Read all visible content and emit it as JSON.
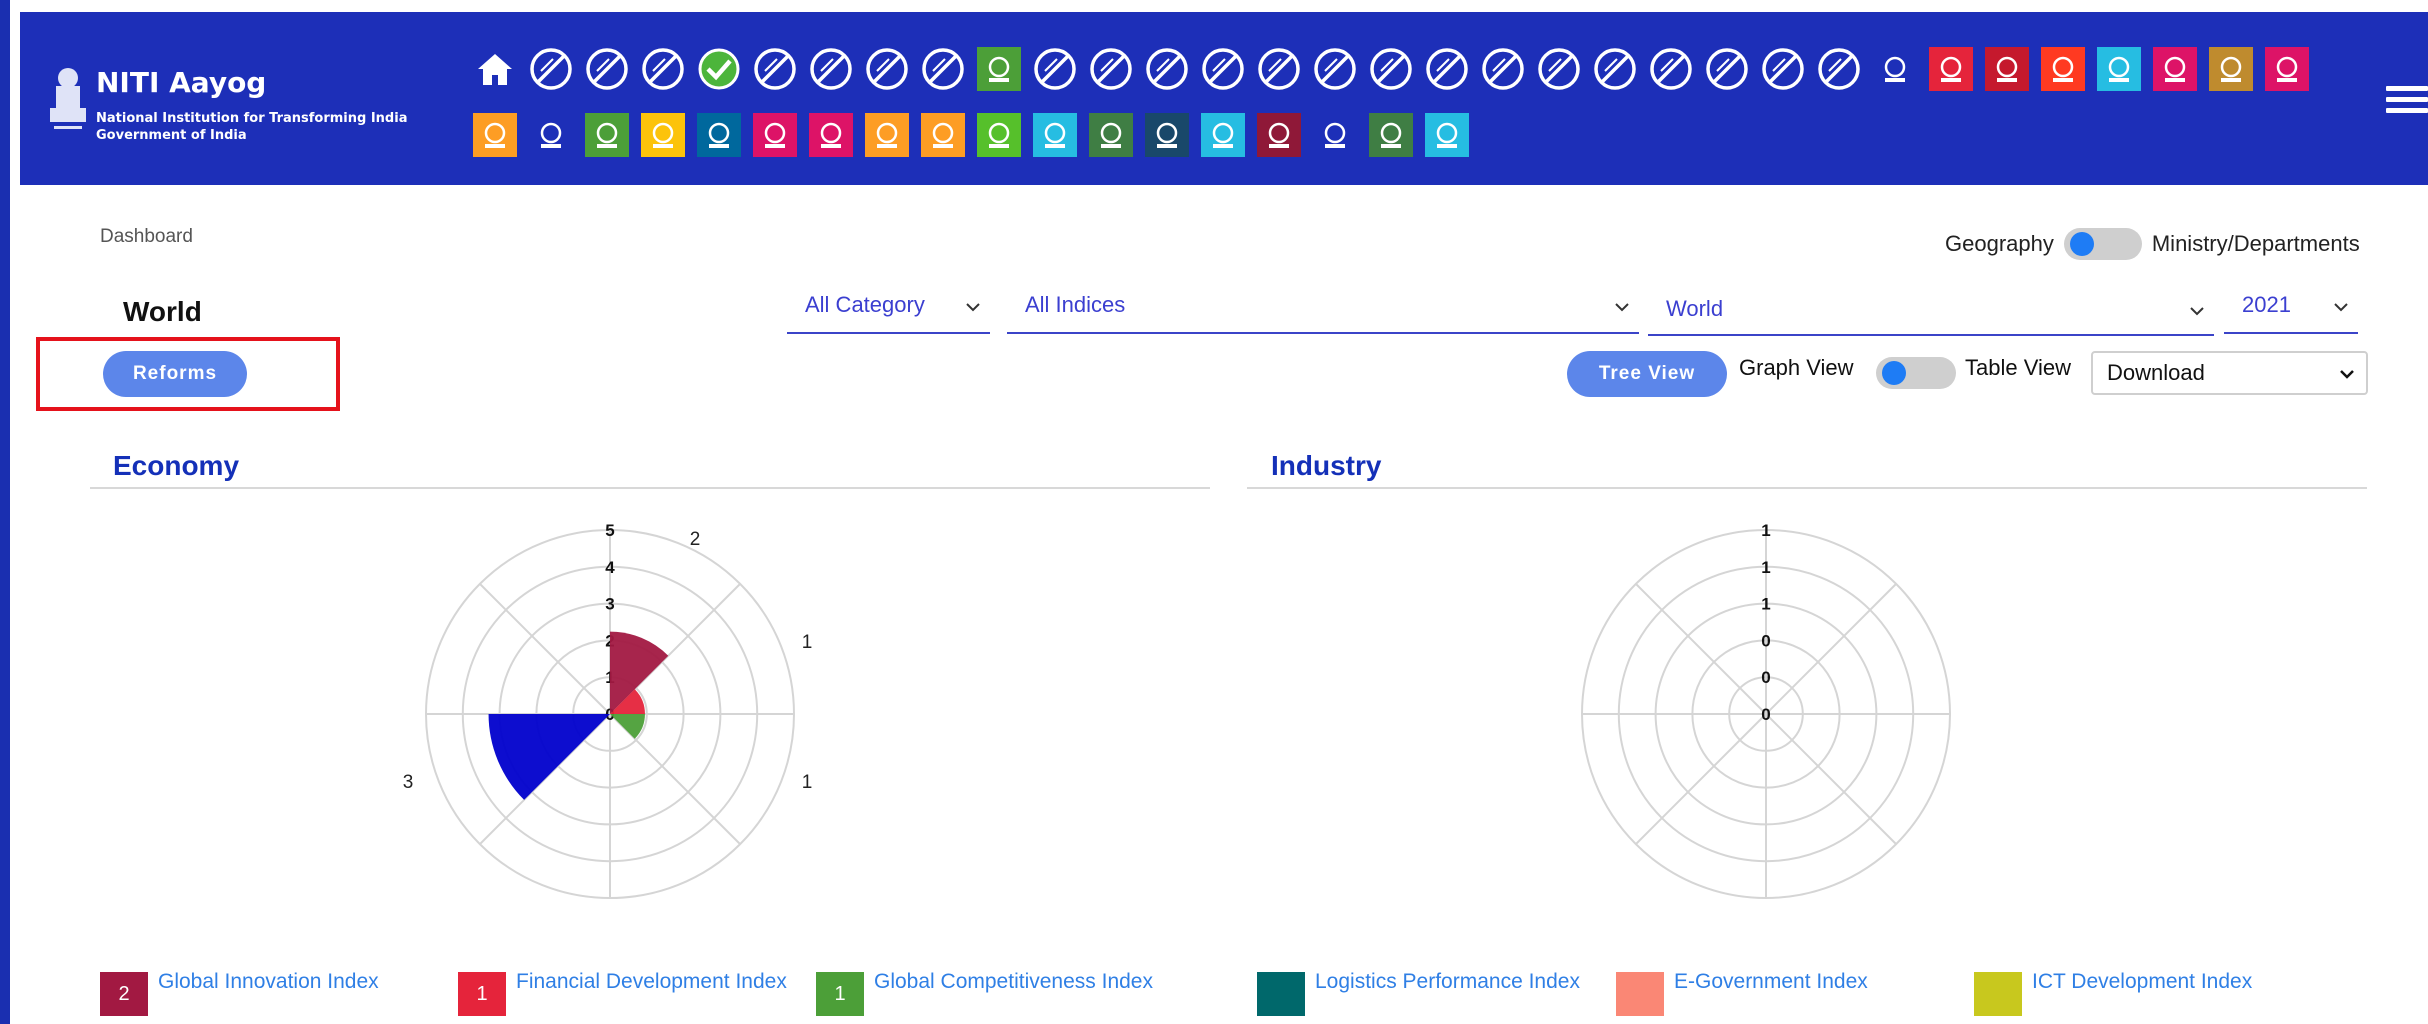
{
  "header": {
    "org_name": "NITI Aayog",
    "org_sub1": "National Institution for Transforming India",
    "org_sub2": "Government of India",
    "row1_icons": [
      {
        "name": "home-icon",
        "color": "#1d2fb8"
      },
      {
        "name": "na-icon",
        "color": "#1d2fb8"
      },
      {
        "name": "na-icon",
        "color": "#1d2fb8"
      },
      {
        "name": "na-icon",
        "color": "#1d2fb8"
      },
      {
        "name": "check-icon",
        "color": "#1d2fb8"
      },
      {
        "name": "na-icon",
        "color": "#1d2fb8"
      },
      {
        "name": "na-icon",
        "color": "#1d2fb8"
      },
      {
        "name": "na-icon",
        "color": "#1d2fb8"
      },
      {
        "name": "na-icon",
        "color": "#1d2fb8"
      },
      {
        "name": "food-bowl-icon",
        "color": "#4c9f38"
      },
      {
        "name": "na-icon",
        "color": "#1d2fb8"
      },
      {
        "name": "na-icon",
        "color": "#1d2fb8"
      },
      {
        "name": "na-icon",
        "color": "#1d2fb8"
      },
      {
        "name": "na-icon",
        "color": "#1d2fb8"
      },
      {
        "name": "na-icon",
        "color": "#1d2fb8"
      },
      {
        "name": "na-icon",
        "color": "#1d2fb8"
      },
      {
        "name": "na-icon",
        "color": "#1d2fb8"
      },
      {
        "name": "na-icon",
        "color": "#1d2fb8"
      },
      {
        "name": "na-icon",
        "color": "#1d2fb8"
      },
      {
        "name": "na-icon",
        "color": "#1d2fb8"
      },
      {
        "name": "na-icon",
        "color": "#1d2fb8"
      },
      {
        "name": "na-icon",
        "color": "#1d2fb8"
      },
      {
        "name": "na-icon",
        "color": "#1d2fb8"
      },
      {
        "name": "na-icon",
        "color": "#1d2fb8"
      },
      {
        "name": "na-icon",
        "color": "#1d2fb8"
      },
      {
        "name": "globe-icon",
        "color": "#1d2fb8"
      },
      {
        "name": "hands-coins-icon",
        "color": "#e5243b"
      },
      {
        "name": "education-icon",
        "color": "#c5192d"
      },
      {
        "name": "gender-icon",
        "color": "#ff3a21"
      },
      {
        "name": "justice-scale-icon",
        "color": "#26bde2"
      },
      {
        "name": "certificate-icon",
        "color": "#dd1367"
      },
      {
        "name": "chart-board-icon",
        "color": "#bf8b2e"
      },
      {
        "name": "worker-icon",
        "color": "#dd1367"
      }
    ],
    "row2_icons": [
      {
        "name": "fruit-icon",
        "color": "#fd9d24"
      },
      {
        "name": "dove-icon",
        "color": "#1d2fb8"
      },
      {
        "name": "newspaper-icon",
        "color": "#4c9f38"
      },
      {
        "name": "handshake-icon",
        "color": "#fcc30b"
      },
      {
        "name": "gavel-icon",
        "color": "#00689d"
      },
      {
        "name": "raised-hands-icon",
        "color": "#dd1367"
      },
      {
        "name": "earth-icon",
        "color": "#dd1367"
      },
      {
        "name": "sprout-icon",
        "color": "#fd9d24"
      },
      {
        "name": "network-icon",
        "color": "#fd9d24"
      },
      {
        "name": "sparkle-icon",
        "color": "#56c02b"
      },
      {
        "name": "bar-chart-icon",
        "color": "#26bde2"
      },
      {
        "name": "bank-icon",
        "color": "#3f7e44"
      },
      {
        "name": "truck-icon",
        "color": "#19486a"
      },
      {
        "name": "target-icon",
        "color": "#26bde2"
      },
      {
        "name": "report-icon",
        "color": "#8f1838"
      },
      {
        "name": "people-icon",
        "color": "#1d2fb8"
      },
      {
        "name": "money-stack-icon",
        "color": "#3f7e44"
      },
      {
        "name": "lightbulb-icon",
        "color": "#26bde2"
      }
    ]
  },
  "breadcrumb": "Dashboard",
  "toggle": {
    "left": "Geography",
    "right": "Ministry/Departments"
  },
  "geo_title": "World",
  "filters": {
    "category": "All Category",
    "indices": "All Indices",
    "geography": "World",
    "year": "2021"
  },
  "buttons": {
    "reforms": "Reforms",
    "tree_view": "Tree View"
  },
  "view_toggle": {
    "left": "Graph View",
    "right": "Table View"
  },
  "download": "Download",
  "sections": {
    "economy": {
      "title": "Economy",
      "ring_labels": [
        "5",
        "4",
        "3",
        "2",
        "1",
        "0"
      ],
      "outer_labels": [
        "2",
        "1",
        "1",
        "3"
      ]
    },
    "industry": {
      "title": "Industry",
      "ring_labels": [
        "1",
        "1",
        "1",
        "0",
        "0",
        "0"
      ]
    }
  },
  "legend": [
    {
      "badge": "2",
      "label": "Global Innovation Index",
      "color": "#a21942"
    },
    {
      "badge": "1",
      "label": "Financial Development Index",
      "color": "#e5243b"
    },
    {
      "badge": "1",
      "label": "Global Competitiveness Index",
      "color": "#4c9f38"
    },
    {
      "badge": "",
      "label": "Logistics Performance Index",
      "color": "#00686b"
    },
    {
      "badge": "",
      "label": "E-Government Index",
      "color": "#fa8775"
    },
    {
      "badge": "",
      "label": "ICT Development Index",
      "color": "#c8c81e"
    }
  ],
  "chart_data": [
    {
      "type": "polar-area",
      "title": "Economy",
      "rmax": 5,
      "ticks": [
        0,
        1,
        2,
        3,
        4,
        5
      ],
      "series": [
        {
          "name": "Global Innovation Index",
          "value": 2,
          "color": "#a21942"
        },
        {
          "name": "Financial Development Index",
          "value": 1,
          "color": "#e5243b"
        },
        {
          "name": "Global Competitiveness Index",
          "value": 1,
          "color": "#4c9f38"
        },
        {
          "value": 3,
          "color": "#0000cc"
        }
      ]
    },
    {
      "type": "polar-area",
      "title": "Industry",
      "ticks": [
        "0",
        "0",
        "0",
        "1",
        "1",
        "1"
      ],
      "series": []
    }
  ]
}
